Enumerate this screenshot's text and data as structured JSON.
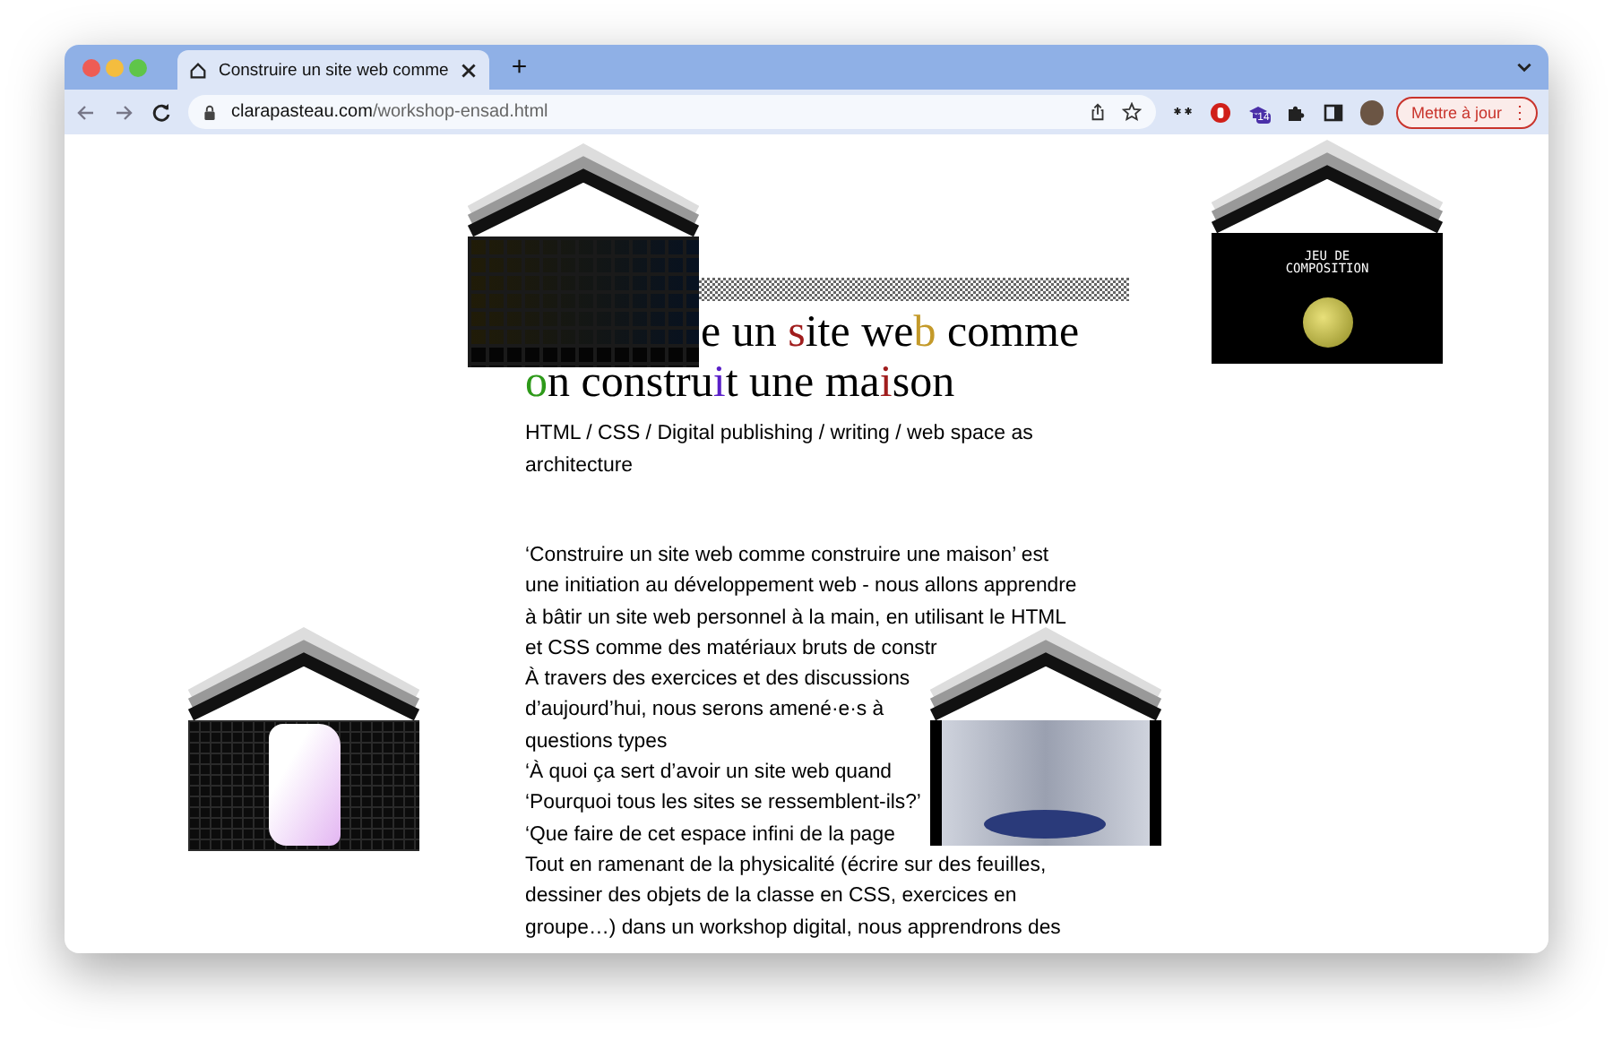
{
  "window": {
    "tab": {
      "title": "Construire un site web comme",
      "selected": true
    },
    "new_tab": "+",
    "address": {
      "host": "clarapasteau.com",
      "path": "/workshop-ensad.html"
    },
    "extension_badge": "14",
    "update_button": "Mettre à jour",
    "menu": "⋮"
  },
  "page": {
    "title_lines": [
      [
        {
          "text": "e un "
        },
        {
          "text": "s",
          "color": "#a01d1d"
        },
        {
          "text": "ite we"
        },
        {
          "text": "b",
          "color": "#c49a2a"
        },
        {
          "text": " comme"
        }
      ],
      [
        {
          "text": "o",
          "color": "#2e9a1a"
        },
        {
          "text": "n constru"
        },
        {
          "text": "i",
          "color": "#5a20c8"
        },
        {
          "text": "t une ma"
        },
        {
          "text": "i",
          "color": "#a01d1d"
        },
        {
          "text": "son"
        }
      ]
    ],
    "subtitle": "HTML / CSS / Digital publishing / writing / web space as architecture",
    "paragraph_lines": [
      "‘Construire un site web comme construire une maison’ est",
      "une initiation au développement web - nous allons apprendre",
      "à bâtir un site web personnel à la main, en utilisant le HTML",
      "et CSS comme des matériaux bruts de constr",
      "À travers des exercices et des discussions",
      "d’aujourd’hui, nous serons amené·e·s à",
      "questions types",
      "‘À quoi ça sert d’avoir un site web quand",
      "‘Pourquoi tous les sites se ressemblent-ils?’",
      "‘Que faire de cet espace infini de la page",
      "Tout en ramenant de la physicalité (écrire sur des feuilles,",
      "dessiner des objets de la classe en CSS, exercices en",
      "groupe…) dans un workshop digital, nous apprendrons des"
    ],
    "houses": [
      {
        "kind": "grid"
      },
      {
        "kind": "composition",
        "lines": [
          "JEU DE",
          "COMPOSITION"
        ]
      },
      {
        "kind": "render"
      },
      {
        "kind": "room"
      }
    ]
  }
}
